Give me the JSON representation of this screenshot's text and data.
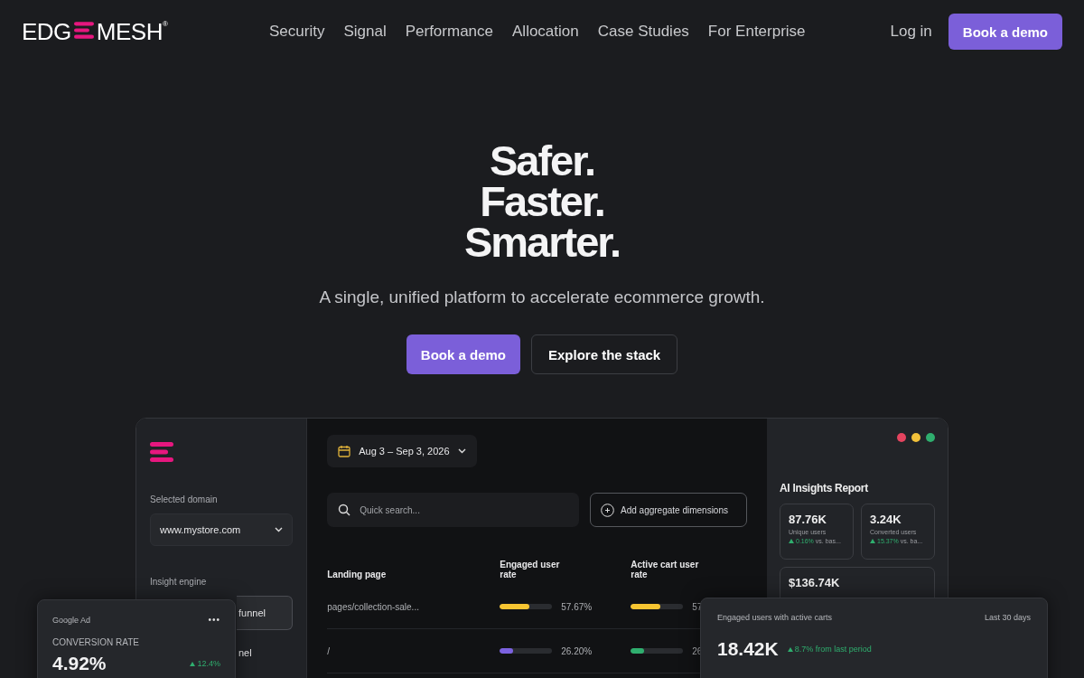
{
  "logo": {
    "left": "EDG",
    "right": "MESH",
    "mark": "®"
  },
  "nav": {
    "links": [
      "Security",
      "Signal",
      "Performance",
      "Allocation",
      "Case Studies",
      "For Enterprise"
    ],
    "login": "Log in",
    "cta": "Book a demo"
  },
  "hero": {
    "headline": [
      "Safer.",
      "Faster.",
      "Smarter."
    ],
    "subtitle": "A single, unified platform to accelerate ecommerce growth.",
    "buttons": [
      {
        "label": "Book a demo",
        "kind": "primary"
      },
      {
        "label": "Explore the stack",
        "kind": "outline"
      }
    ]
  },
  "dashboard": {
    "sidebar": {
      "domain_label": "Selected domain",
      "domain": "www.mystore.com",
      "engine_label": "Insight engine",
      "items": [
        {
          "label": "funnel",
          "selected": true
        },
        {
          "label": "nel",
          "selected": false
        }
      ]
    },
    "date_range": "Aug 3 – Sep 3, 2026",
    "search": {
      "placeholder": "Quick search..."
    },
    "add_button": "Add aggregate dimensions",
    "table": {
      "columns": [
        "Landing page",
        "Engaged user rate",
        "Active cart user rate"
      ],
      "rows": [
        {
          "page": "pages/collection-sale...",
          "engaged": {
            "level": 0.57,
            "color": "#f7c531",
            "value": "57.67%"
          },
          "active": {
            "level": 0.57,
            "color": "#f7c531",
            "value": "57"
          }
        },
        {
          "page": "/",
          "engaged": {
            "level": 0.26,
            "color": "#7c62e0",
            "value": "26.20%"
          },
          "active": {
            "level": 0.26,
            "color": "#2fae6e",
            "value": "26"
          }
        }
      ]
    },
    "insights": {
      "title": "AI Insights Report",
      "cards": [
        {
          "value": "87.76K",
          "label": "Unique users",
          "delta": "0.16%",
          "note": "vs. bas..."
        },
        {
          "value": "3.24K",
          "label": "Converted users",
          "delta": "15.37%",
          "note": "vs. ba..."
        },
        {
          "value": "$136.74K"
        }
      ]
    }
  },
  "ad_card": {
    "source": "Google Ad",
    "menu": "•••",
    "metric": "CONVERSION RATE",
    "value": "4.92%",
    "delta": "12.4%"
  },
  "engaged_card": {
    "title": "Engaged users with active carts",
    "period": "Last 30 days",
    "value": "18.42K",
    "delta": "8.7% from last period"
  }
}
